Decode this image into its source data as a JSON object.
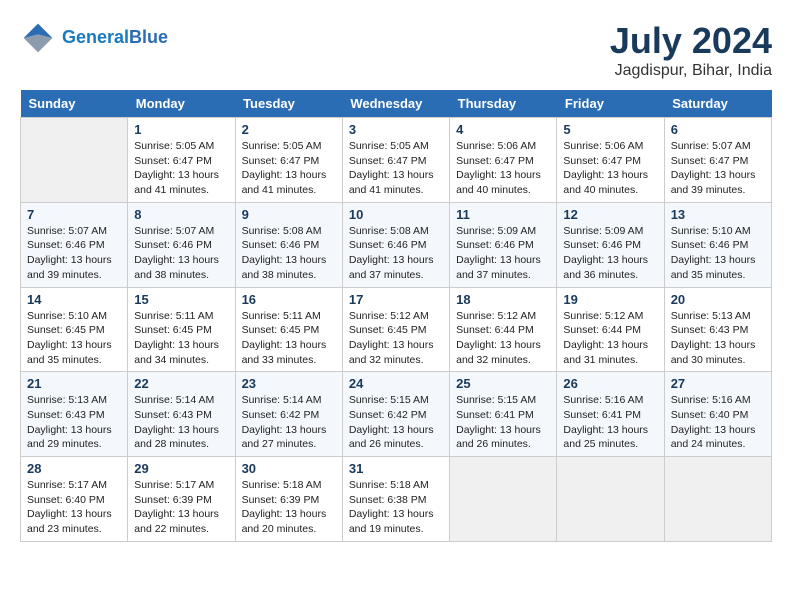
{
  "header": {
    "logo_line1": "General",
    "logo_line2": "Blue",
    "month_year": "July 2024",
    "location": "Jagdispur, Bihar, India"
  },
  "days_of_week": [
    "Sunday",
    "Monday",
    "Tuesday",
    "Wednesday",
    "Thursday",
    "Friday",
    "Saturday"
  ],
  "weeks": [
    [
      {
        "day": "",
        "sunrise": "",
        "sunset": "",
        "daylight": ""
      },
      {
        "day": "1",
        "sunrise": "Sunrise: 5:05 AM",
        "sunset": "Sunset: 6:47 PM",
        "daylight": "Daylight: 13 hours and 41 minutes."
      },
      {
        "day": "2",
        "sunrise": "Sunrise: 5:05 AM",
        "sunset": "Sunset: 6:47 PM",
        "daylight": "Daylight: 13 hours and 41 minutes."
      },
      {
        "day": "3",
        "sunrise": "Sunrise: 5:05 AM",
        "sunset": "Sunset: 6:47 PM",
        "daylight": "Daylight: 13 hours and 41 minutes."
      },
      {
        "day": "4",
        "sunrise": "Sunrise: 5:06 AM",
        "sunset": "Sunset: 6:47 PM",
        "daylight": "Daylight: 13 hours and 40 minutes."
      },
      {
        "day": "5",
        "sunrise": "Sunrise: 5:06 AM",
        "sunset": "Sunset: 6:47 PM",
        "daylight": "Daylight: 13 hours and 40 minutes."
      },
      {
        "day": "6",
        "sunrise": "Sunrise: 5:07 AM",
        "sunset": "Sunset: 6:47 PM",
        "daylight": "Daylight: 13 hours and 39 minutes."
      }
    ],
    [
      {
        "day": "7",
        "sunrise": "Sunrise: 5:07 AM",
        "sunset": "Sunset: 6:46 PM",
        "daylight": "Daylight: 13 hours and 39 minutes."
      },
      {
        "day": "8",
        "sunrise": "Sunrise: 5:07 AM",
        "sunset": "Sunset: 6:46 PM",
        "daylight": "Daylight: 13 hours and 38 minutes."
      },
      {
        "day": "9",
        "sunrise": "Sunrise: 5:08 AM",
        "sunset": "Sunset: 6:46 PM",
        "daylight": "Daylight: 13 hours and 38 minutes."
      },
      {
        "day": "10",
        "sunrise": "Sunrise: 5:08 AM",
        "sunset": "Sunset: 6:46 PM",
        "daylight": "Daylight: 13 hours and 37 minutes."
      },
      {
        "day": "11",
        "sunrise": "Sunrise: 5:09 AM",
        "sunset": "Sunset: 6:46 PM",
        "daylight": "Daylight: 13 hours and 37 minutes."
      },
      {
        "day": "12",
        "sunrise": "Sunrise: 5:09 AM",
        "sunset": "Sunset: 6:46 PM",
        "daylight": "Daylight: 13 hours and 36 minutes."
      },
      {
        "day": "13",
        "sunrise": "Sunrise: 5:10 AM",
        "sunset": "Sunset: 6:46 PM",
        "daylight": "Daylight: 13 hours and 35 minutes."
      }
    ],
    [
      {
        "day": "14",
        "sunrise": "Sunrise: 5:10 AM",
        "sunset": "Sunset: 6:45 PM",
        "daylight": "Daylight: 13 hours and 35 minutes."
      },
      {
        "day": "15",
        "sunrise": "Sunrise: 5:11 AM",
        "sunset": "Sunset: 6:45 PM",
        "daylight": "Daylight: 13 hours and 34 minutes."
      },
      {
        "day": "16",
        "sunrise": "Sunrise: 5:11 AM",
        "sunset": "Sunset: 6:45 PM",
        "daylight": "Daylight: 13 hours and 33 minutes."
      },
      {
        "day": "17",
        "sunrise": "Sunrise: 5:12 AM",
        "sunset": "Sunset: 6:45 PM",
        "daylight": "Daylight: 13 hours and 32 minutes."
      },
      {
        "day": "18",
        "sunrise": "Sunrise: 5:12 AM",
        "sunset": "Sunset: 6:44 PM",
        "daylight": "Daylight: 13 hours and 32 minutes."
      },
      {
        "day": "19",
        "sunrise": "Sunrise: 5:12 AM",
        "sunset": "Sunset: 6:44 PM",
        "daylight": "Daylight: 13 hours and 31 minutes."
      },
      {
        "day": "20",
        "sunrise": "Sunrise: 5:13 AM",
        "sunset": "Sunset: 6:43 PM",
        "daylight": "Daylight: 13 hours and 30 minutes."
      }
    ],
    [
      {
        "day": "21",
        "sunrise": "Sunrise: 5:13 AM",
        "sunset": "Sunset: 6:43 PM",
        "daylight": "Daylight: 13 hours and 29 minutes."
      },
      {
        "day": "22",
        "sunrise": "Sunrise: 5:14 AM",
        "sunset": "Sunset: 6:43 PM",
        "daylight": "Daylight: 13 hours and 28 minutes."
      },
      {
        "day": "23",
        "sunrise": "Sunrise: 5:14 AM",
        "sunset": "Sunset: 6:42 PM",
        "daylight": "Daylight: 13 hours and 27 minutes."
      },
      {
        "day": "24",
        "sunrise": "Sunrise: 5:15 AM",
        "sunset": "Sunset: 6:42 PM",
        "daylight": "Daylight: 13 hours and 26 minutes."
      },
      {
        "day": "25",
        "sunrise": "Sunrise: 5:15 AM",
        "sunset": "Sunset: 6:41 PM",
        "daylight": "Daylight: 13 hours and 26 minutes."
      },
      {
        "day": "26",
        "sunrise": "Sunrise: 5:16 AM",
        "sunset": "Sunset: 6:41 PM",
        "daylight": "Daylight: 13 hours and 25 minutes."
      },
      {
        "day": "27",
        "sunrise": "Sunrise: 5:16 AM",
        "sunset": "Sunset: 6:40 PM",
        "daylight": "Daylight: 13 hours and 24 minutes."
      }
    ],
    [
      {
        "day": "28",
        "sunrise": "Sunrise: 5:17 AM",
        "sunset": "Sunset: 6:40 PM",
        "daylight": "Daylight: 13 hours and 23 minutes."
      },
      {
        "day": "29",
        "sunrise": "Sunrise: 5:17 AM",
        "sunset": "Sunset: 6:39 PM",
        "daylight": "Daylight: 13 hours and 22 minutes."
      },
      {
        "day": "30",
        "sunrise": "Sunrise: 5:18 AM",
        "sunset": "Sunset: 6:39 PM",
        "daylight": "Daylight: 13 hours and 20 minutes."
      },
      {
        "day": "31",
        "sunrise": "Sunrise: 5:18 AM",
        "sunset": "Sunset: 6:38 PM",
        "daylight": "Daylight: 13 hours and 19 minutes."
      },
      {
        "day": "",
        "sunrise": "",
        "sunset": "",
        "daylight": ""
      },
      {
        "day": "",
        "sunrise": "",
        "sunset": "",
        "daylight": ""
      },
      {
        "day": "",
        "sunrise": "",
        "sunset": "",
        "daylight": ""
      }
    ]
  ]
}
